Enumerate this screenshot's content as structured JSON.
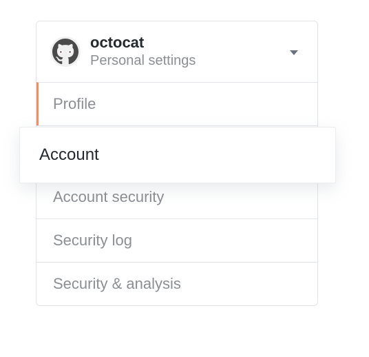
{
  "header": {
    "username": "octocat",
    "subtitle": "Personal settings"
  },
  "menu": {
    "items": [
      {
        "label": "Profile"
      },
      {
        "label": "Account"
      },
      {
        "label": "Account security"
      },
      {
        "label": "Security log"
      },
      {
        "label": "Security & analysis"
      }
    ]
  }
}
